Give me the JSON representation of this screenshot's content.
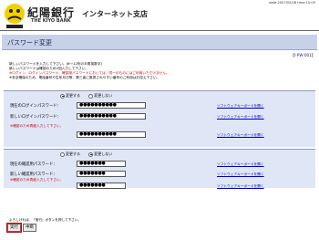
{
  "header": {
    "bank_name": "紀陽銀行",
    "branch_name": "インターネット支店",
    "bank_name_en": "THE KIYO BANK",
    "datetime": "date:2007/05/28 time:15:05"
  },
  "page": {
    "title": "パスワード変更",
    "screen_id": "【I-PW-001】"
  },
  "intro": {
    "line1": "新しいパスワードを入力して下さい。(6〜12桁の半角英数字)",
    "line2": "新しいパスワードは確認のため2回入力して下さい。",
    "line3": "※ログイン、ログインパスワード、確認用パスワードにおいては、同一のものにはご利用いただけません。",
    "line4": "※安全確保のため、電話番号や生年月日等、第三者に推測されやすい番号のご利用はお控え下さい。"
  },
  "login_section": {
    "radio_change": "変更する",
    "radio_nochange": "変更しない",
    "current_label": "現在のログインパスワード：",
    "current_value": "●●●●●●●●●●",
    "new_label": "新しいログインパスワード：",
    "new_value": "●●●●●●●●●●",
    "confirm_note": "※確認のため再度入力して下さい。",
    "confirm_value": "●●●●●●●●●●",
    "keyboard_link": "ソフトウェアキーボードを開く"
  },
  "confirm_section": {
    "radio_change": "変更する",
    "radio_nochange": "変更しない",
    "current_label": "現在の確認用パスワード：",
    "current_value": "●●●●●●●",
    "new_label": "新しい確認用パスワード：",
    "new_value": "●●●●●●●",
    "confirm_note": "※確認のため再度入力して下さい。",
    "confirm_value": "●●●●●●●",
    "keyboard_link": "ソフトウェアキーボードを開く"
  },
  "footer": {
    "hint": "よろしければ、「実行」ボタンを押して下さい。",
    "execute_label": "実行",
    "cancel_label": "中断"
  },
  "colors": {
    "title_bar": "#c7d2e8",
    "section_bg": "#dfe6f5",
    "link": "#0000cc",
    "warning": "#cc0000",
    "logo": "#f2d000"
  }
}
